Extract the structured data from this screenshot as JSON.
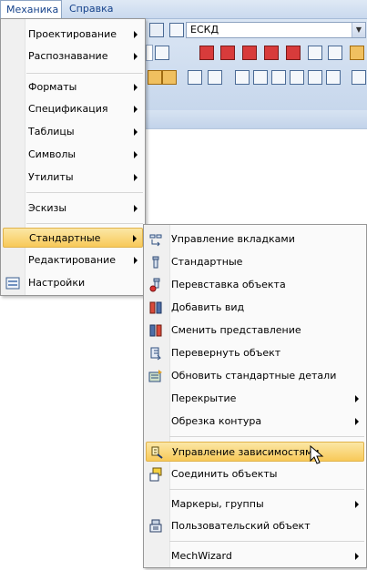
{
  "menubar": {
    "mechanics": "Механика",
    "help": "Справка"
  },
  "toolbar": {
    "standard_combo": "ЕСКД"
  },
  "mechanics_menu": {
    "items": [
      {
        "label": "Проектирование",
        "submenu": true
      },
      {
        "label": "Распознавание",
        "submenu": true
      },
      {
        "label": "Форматы",
        "submenu": true
      },
      {
        "label": "Спецификация",
        "submenu": true
      },
      {
        "label": "Таблицы",
        "submenu": true
      },
      {
        "label": "Символы",
        "submenu": true
      },
      {
        "label": "Утилиты",
        "submenu": true
      },
      {
        "label": "Эскизы",
        "submenu": true
      },
      {
        "label": "Стандартные",
        "submenu": true,
        "highlighted": true
      },
      {
        "label": "Редактирование",
        "submenu": true
      },
      {
        "label": "Настройки",
        "submenu": false,
        "icon": "settings-icon"
      }
    ]
  },
  "standard_menu": {
    "items": [
      {
        "label": "Управление вкладками",
        "icon": "tab-manage-icon"
      },
      {
        "label": "Стандартные",
        "icon": "standard-part-icon"
      },
      {
        "label": "Перевставка объекта",
        "icon": "reinsert-icon"
      },
      {
        "label": "Добавить вид",
        "icon": "add-view-icon"
      },
      {
        "label": "Сменить представление",
        "icon": "change-view-icon"
      },
      {
        "label": "Перевернуть объект",
        "icon": "flip-icon"
      },
      {
        "label": "Обновить стандартные детали",
        "icon": "refresh-parts-icon"
      },
      {
        "label": "Перекрытие",
        "submenu": true
      },
      {
        "label": "Обрезка контура",
        "submenu": true
      },
      {
        "label": "Управление зависимостями",
        "icon": "dependencies-icon",
        "highlighted": true
      },
      {
        "label": "Соединить объекты",
        "icon": "join-icon"
      },
      {
        "label": "Маркеры, группы",
        "submenu": true
      },
      {
        "label": "Пользовательский объект",
        "icon": "user-object-icon"
      },
      {
        "label": "MechWizard",
        "submenu": true
      }
    ]
  },
  "colors": {
    "highlight": "#f8c958",
    "menu_text": "#15428b"
  }
}
